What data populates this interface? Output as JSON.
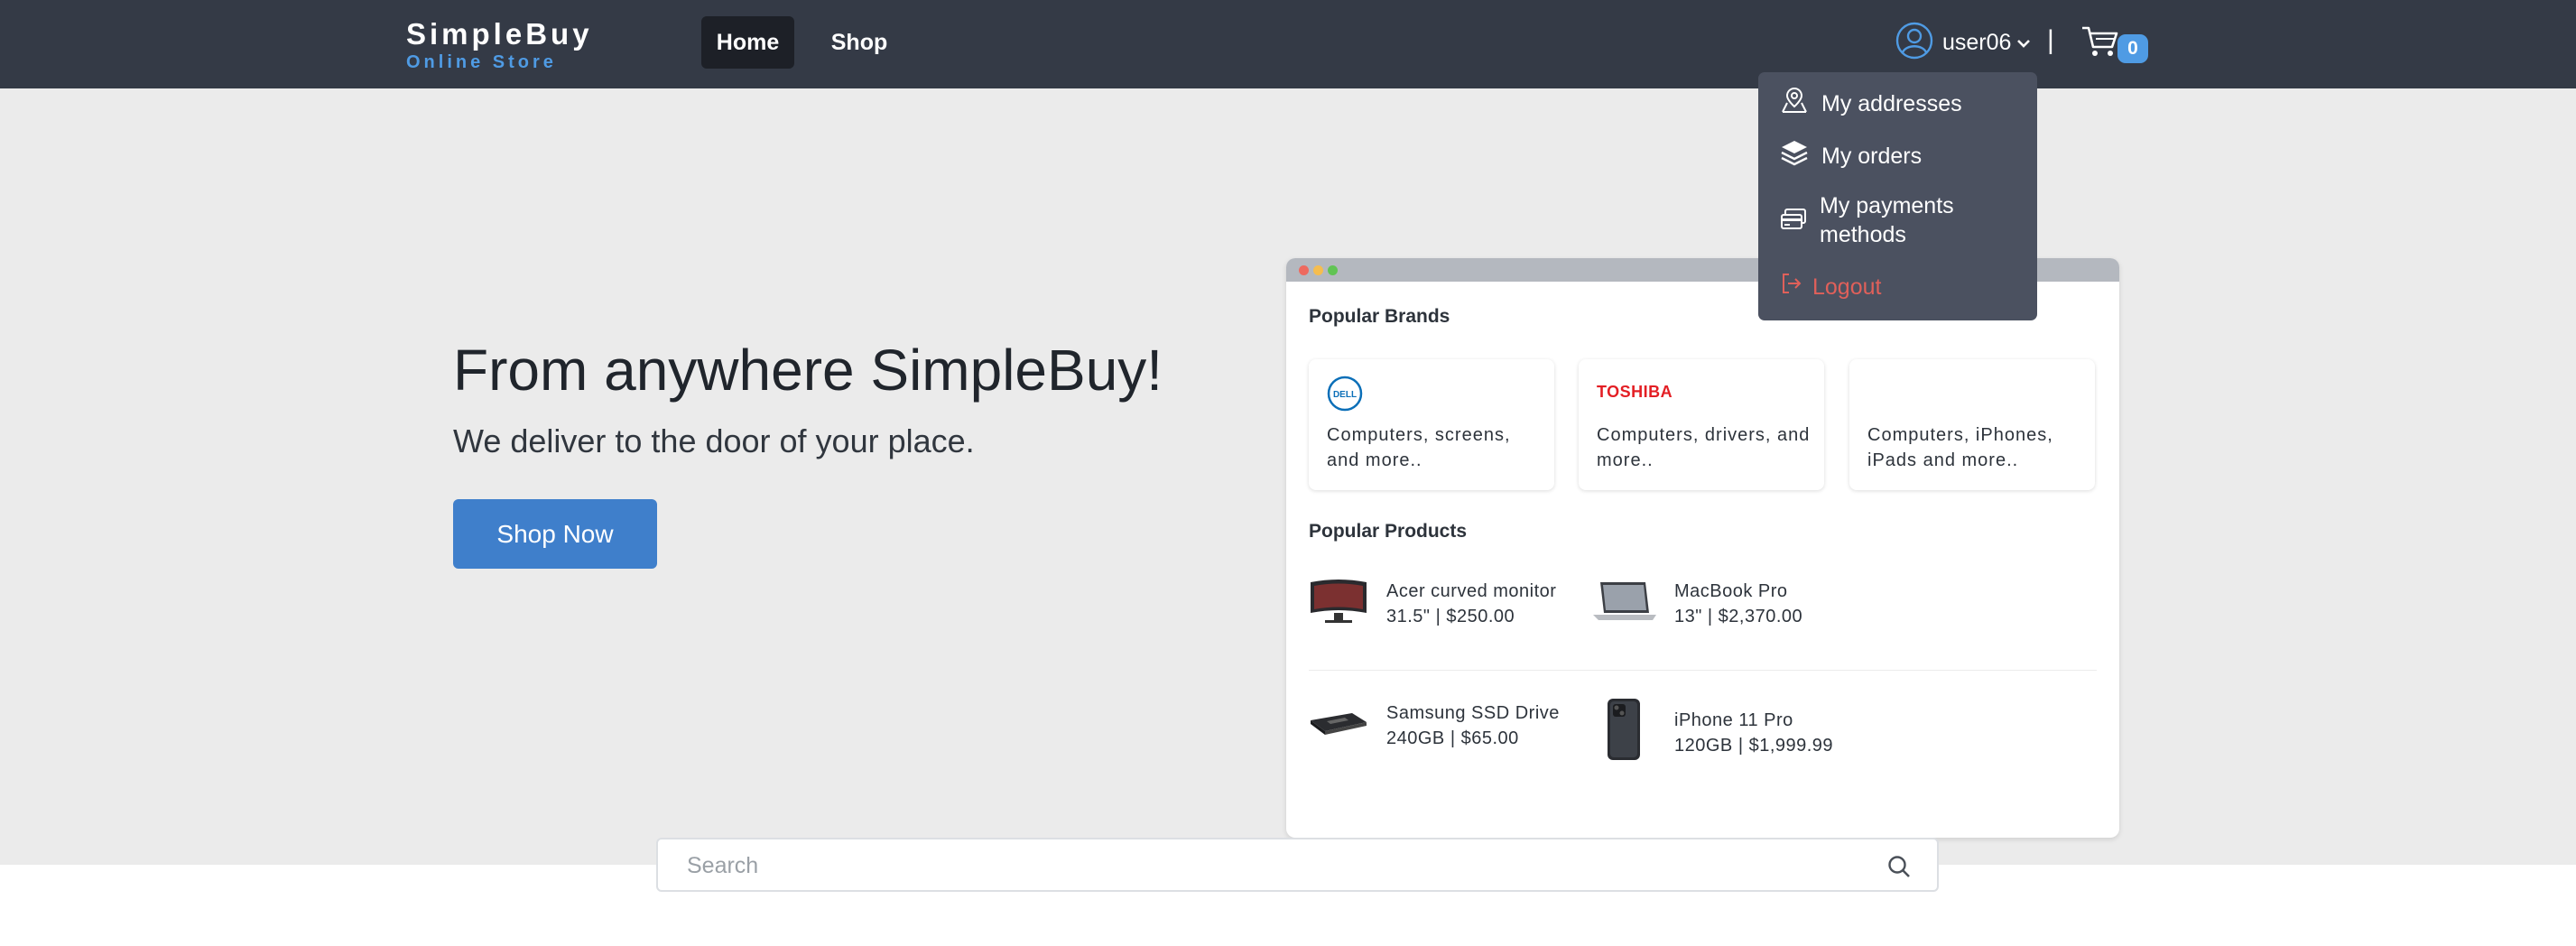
{
  "header": {
    "brand_name": "SimpleBuy",
    "brand_tagline": "Online Store",
    "nav": [
      {
        "label": "Home",
        "active": true
      },
      {
        "label": "Shop",
        "active": false
      }
    ],
    "user": {
      "name": "user06",
      "icon": "user-circle-icon"
    },
    "separator": "|",
    "cart": {
      "icon": "cart-icon",
      "count": "0"
    }
  },
  "dropdown": {
    "items": [
      {
        "label": "My addresses",
        "icon": "map-pin-icon"
      },
      {
        "label": "My orders",
        "icon": "layers-icon"
      },
      {
        "label": "My payments methods",
        "icon": "payment-card-icon"
      },
      {
        "label": "Logout",
        "icon": "logout-icon"
      }
    ]
  },
  "hero": {
    "title": "From anywhere SimpleBuy!",
    "subtitle": "We deliver to the door of your place.",
    "cta": "Shop Now"
  },
  "preview": {
    "brands_title": "Popular Brands",
    "brands": [
      {
        "logo": "DELL",
        "description": "Computers, screens, and more.."
      },
      {
        "logo": "TOSHIBA",
        "description": "Computers, drivers, and more.."
      },
      {
        "logo": "",
        "description": "Computers, iPhones, iPads and more.."
      }
    ],
    "products_title": "Popular Products",
    "products": [
      {
        "name": "Acer curved monitor",
        "detail": "31.5\" | $250.00",
        "icon": "monitor-image"
      },
      {
        "name": "MacBook Pro",
        "detail": "13\" | $2,370.00",
        "icon": "laptop-image"
      },
      {
        "name": "Samsung SSD Drive",
        "detail": "240GB | $65.00",
        "icon": "ssd-image"
      },
      {
        "name": "iPhone 11 Pro",
        "detail": "120GB | $1,999.99",
        "icon": "phone-image"
      }
    ]
  },
  "search": {
    "placeholder": "Search",
    "value": "",
    "icon": "search-icon"
  },
  "colors": {
    "header_bg": "#343a46",
    "accent": "#4f9be4",
    "button": "#3f7fcb",
    "hero_bg": "#ebebeb",
    "dropdown_bg": "#4b5160",
    "logout": "#e0605a"
  }
}
